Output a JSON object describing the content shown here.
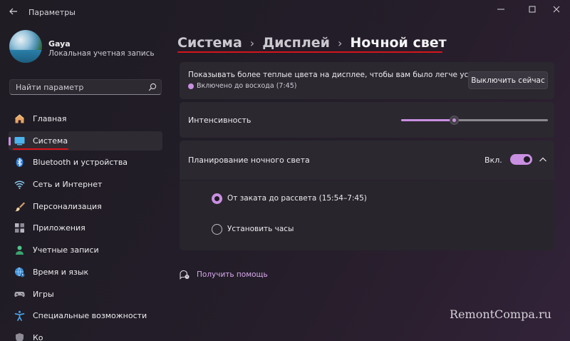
{
  "window": {
    "title": "Параметры"
  },
  "profile": {
    "name": "Gaya",
    "account_type": "Локальная учетная запись"
  },
  "search": {
    "placeholder": "Найти параметр"
  },
  "sidebar": {
    "items": [
      {
        "label": "Главная",
        "icon": "home-icon",
        "active": false
      },
      {
        "label": "Система",
        "icon": "display-icon",
        "active": true
      },
      {
        "label": "Bluetooth и устройства",
        "icon": "bluetooth-icon",
        "active": false
      },
      {
        "label": "Сеть и Интернет",
        "icon": "wifi-icon",
        "active": false
      },
      {
        "label": "Персонализация",
        "icon": "brush-icon",
        "active": false
      },
      {
        "label": "Приложения",
        "icon": "apps-icon",
        "active": false
      },
      {
        "label": "Учетные записи",
        "icon": "people-icon",
        "active": false
      },
      {
        "label": "Время и язык",
        "icon": "globe-clock-icon",
        "active": false
      },
      {
        "label": "Игры",
        "icon": "gamepad-icon",
        "active": false
      },
      {
        "label": "Специальные возможности",
        "icon": "accessibility-icon",
        "active": false
      },
      {
        "label": "Ко",
        "icon": "shield-icon",
        "active": false
      }
    ]
  },
  "breadcrumb": {
    "items": [
      "Система",
      "Дисплей",
      "Ночной свет"
    ]
  },
  "night_light": {
    "description": "Показывать более теплые цвета на дисплее, чтобы вам было легче уснуть",
    "status": "Включено до восхода (7:45)",
    "turn_off_button": "Выключить сейчас",
    "intensity_label": "Интенсивность",
    "intensity_value": 0.36,
    "schedule_label": "Планирование ночного света",
    "schedule_state": "Вкл.",
    "schedule_enabled": true,
    "schedule_options": [
      {
        "label": "От заката до рассвета (15:54–7:45)",
        "checked": true
      },
      {
        "label": "Установить часы",
        "checked": false
      }
    ]
  },
  "help": {
    "label": "Получить помощь"
  },
  "watermark": "RemontCompa.ru",
  "colors": {
    "accent": "#c98fe0",
    "annotation": "#d6141a"
  }
}
